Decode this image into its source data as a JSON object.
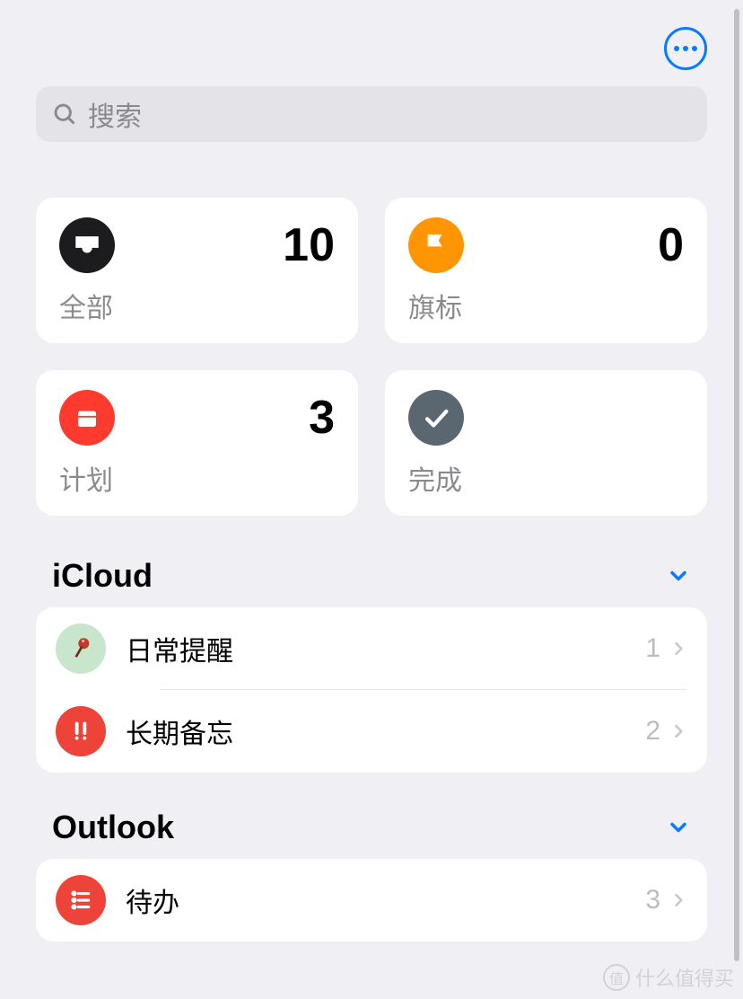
{
  "search": {
    "placeholder": "搜索"
  },
  "cards": {
    "all": {
      "label": "全部",
      "count": "10",
      "icon_bg": "#1c1c1e"
    },
    "flagged": {
      "label": "旗标",
      "count": "0",
      "icon_bg": "#ff9500"
    },
    "scheduled": {
      "label": "计划",
      "count": "3",
      "icon_bg": "#ff3b30"
    },
    "done": {
      "label": "完成",
      "count": "",
      "icon_bg": "#5b6770"
    }
  },
  "sections": {
    "icloud": {
      "title": "iCloud",
      "lists": [
        {
          "label": "日常提醒",
          "count": "1",
          "icon_bg": "#c7e6cb"
        },
        {
          "label": "长期备忘",
          "count": "2",
          "icon_bg": "#ee4339"
        }
      ]
    },
    "outlook": {
      "title": "Outlook",
      "lists": [
        {
          "label": "待办",
          "count": "3",
          "icon_bg": "#ee4339"
        }
      ]
    }
  },
  "watermark": "什么值得买"
}
